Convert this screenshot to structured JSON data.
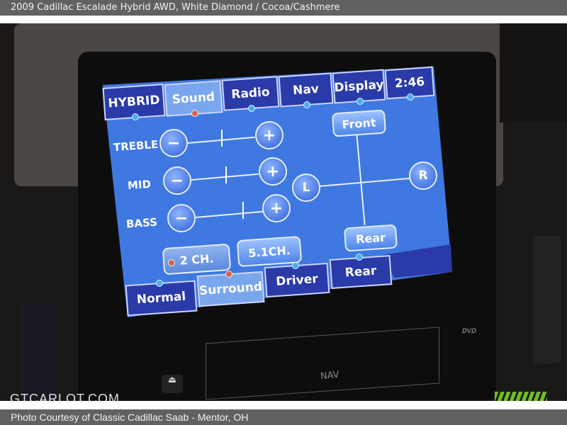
{
  "header": {
    "title": "2009 Cadillac Escalade Hybrid AWD,  White Diamond / Cocoa/Cashmere"
  },
  "footer": {
    "credit": "Photo Courtesy of Classic Cadillac Saab - Mentor, OH"
  },
  "watermark": "GTCARLOT.COM",
  "screen": {
    "top_tabs": [
      {
        "label": "HYBRID"
      },
      {
        "label": "Sound",
        "active": true
      },
      {
        "label": "Radio"
      },
      {
        "label": "Nav"
      },
      {
        "label": "Display"
      },
      {
        "label": "2:46"
      }
    ],
    "eq": [
      {
        "label": "TREBLE"
      },
      {
        "label": "MID"
      },
      {
        "label": "BASS"
      }
    ],
    "minus": "−",
    "plus": "+",
    "balance": {
      "left": "L",
      "right": "R",
      "front": "Front",
      "rear": "Rear"
    },
    "channels": [
      {
        "label": "2 CH.",
        "selected": true
      },
      {
        "label": "5.1CH."
      }
    ],
    "bottom_tabs": [
      {
        "label": "Normal"
      },
      {
        "label": "Surround",
        "active": true
      },
      {
        "label": "Driver"
      },
      {
        "label": "Rear"
      }
    ]
  },
  "bezel": {
    "nav": "NAV",
    "dvd": "DVD"
  },
  "colors": {
    "screen": "#3f78e0",
    "tab": "#2a3aa8",
    "active_tab": "#7aa6ee"
  }
}
